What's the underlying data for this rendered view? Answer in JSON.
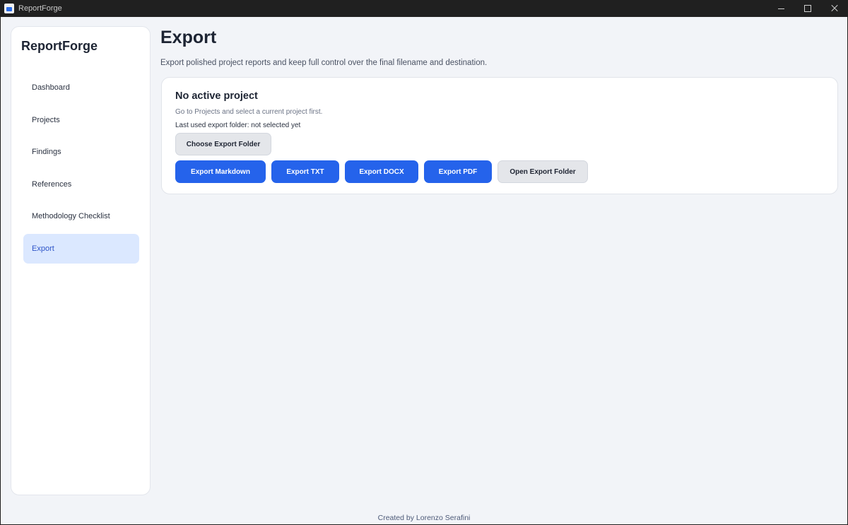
{
  "window": {
    "title": "ReportForge",
    "controls": [
      "minimize-icon",
      "maximize-icon",
      "close-icon"
    ]
  },
  "sidebar": {
    "brand": "ReportForge",
    "items": [
      {
        "label": "Dashboard",
        "active": false
      },
      {
        "label": "Projects",
        "active": false
      },
      {
        "label": "Findings",
        "active": false
      },
      {
        "label": "References",
        "active": false
      },
      {
        "label": "Methodology Checklist",
        "active": false
      },
      {
        "label": "Export",
        "active": true
      }
    ]
  },
  "main": {
    "title": "Export",
    "subtitle": "Export polished project reports and keep full control over the final filename and destination.",
    "card": {
      "title": "No active project",
      "hint": "Go to Projects and select a current project first.",
      "folder_status": "Last used export folder: not selected yet",
      "choose_folder_label": "Choose Export Folder",
      "buttons": {
        "markdown": "Export Markdown",
        "txt": "Export TXT",
        "docx": "Export DOCX",
        "pdf": "Export PDF",
        "open_folder": "Open Export Folder"
      }
    }
  },
  "footer": {
    "credit": "Created by Lorenzo Serafini"
  },
  "colors": {
    "accent": "#2563eb",
    "active_nav_bg": "#dbe8ff",
    "background": "#f2f4f8"
  }
}
